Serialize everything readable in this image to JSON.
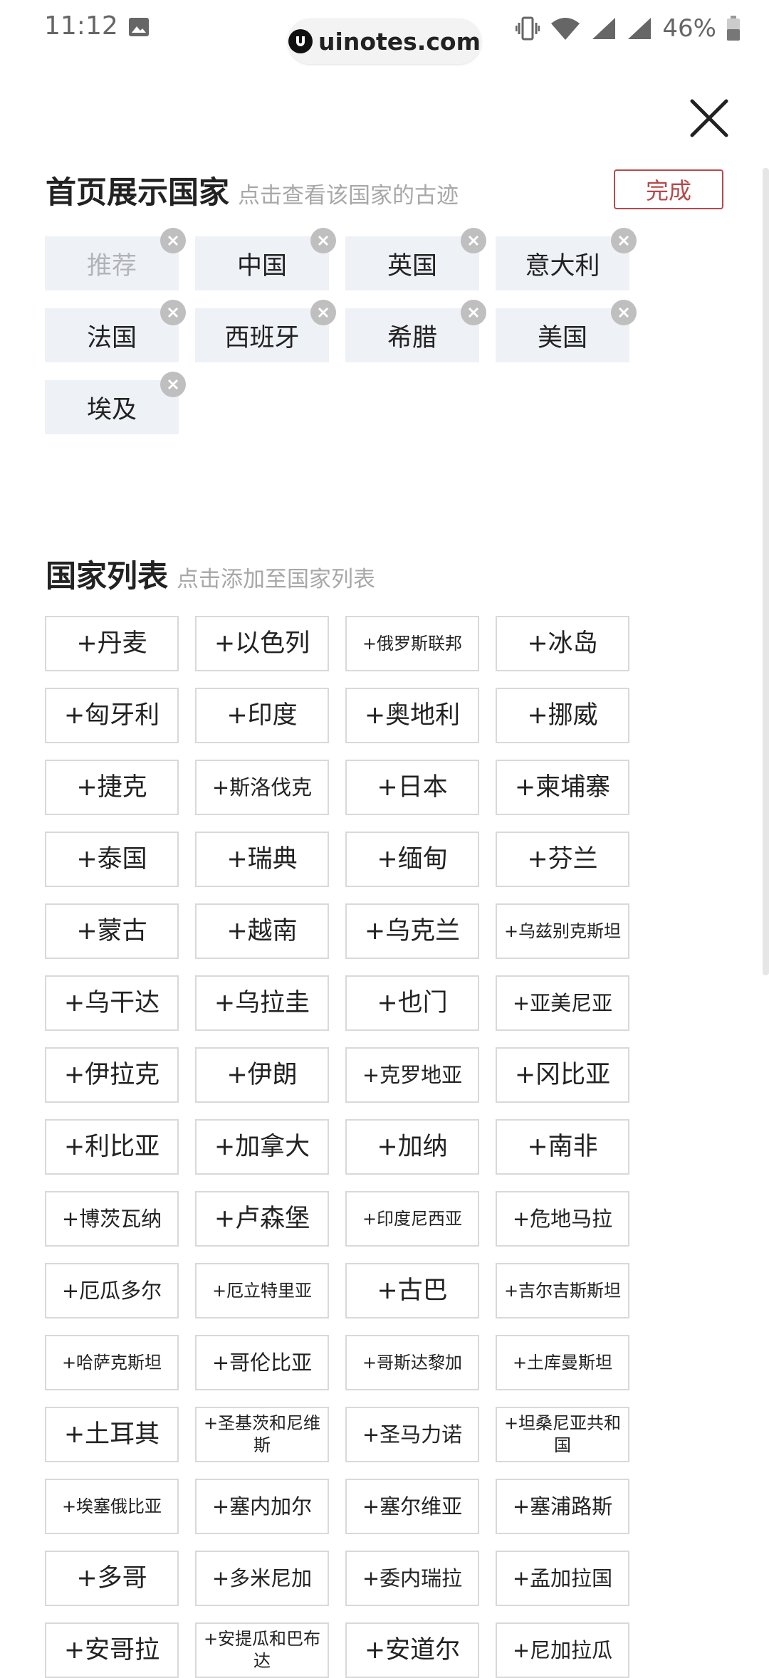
{
  "status": {
    "time": "11:12",
    "battery": "46%",
    "watermark": "uinotes.com"
  },
  "selected": {
    "title": "首页展示国家",
    "hint": "点击查看该国家的古迹",
    "done_label": "完成",
    "items": [
      "推荐",
      "中国",
      "英国",
      "意大利",
      "法国",
      "西班牙",
      "希腊",
      "美国",
      "埃及"
    ]
  },
  "country_list": {
    "title": "国家列表",
    "hint": "点击添加至国家列表",
    "items": [
      "+丹麦",
      "+以色列",
      "+俄罗斯联邦",
      "+冰岛",
      "+匈牙利",
      "+印度",
      "+奥地利",
      "+挪威",
      "+捷克",
      "+斯洛伐克",
      "+日本",
      "+柬埔寨",
      "+泰国",
      "+瑞典",
      "+缅甸",
      "+芬兰",
      "+蒙古",
      "+越南",
      "+乌克兰",
      "+乌兹别克斯坦",
      "+乌干达",
      "+乌拉圭",
      "+也门",
      "+亚美尼亚",
      "+伊拉克",
      "+伊朗",
      "+克罗地亚",
      "+冈比亚",
      "+利比亚",
      "+加拿大",
      "+加纳",
      "+南非",
      "+博茨瓦纳",
      "+卢森堡",
      "+印度尼西亚",
      "+危地马拉",
      "+厄瓜多尔",
      "+厄立特里亚",
      "+古巴",
      "+吉尔吉斯斯坦",
      "+哈萨克斯坦",
      "+哥伦比亚",
      "+哥斯达黎加",
      "+土库曼斯坦",
      "+土耳其",
      "+圣基茨和尼维斯",
      "+圣马力诺",
      "+坦桑尼亚共和国",
      "+埃塞俄比亚",
      "+塞内加尔",
      "+塞尔维亚",
      "+塞浦路斯",
      "+多哥",
      "+多米尼加",
      "+委内瑞拉",
      "+孟加拉国",
      "+安哥拉",
      "+安提瓜和巴布达",
      "+安道尔",
      "+尼加拉瓜"
    ]
  }
}
